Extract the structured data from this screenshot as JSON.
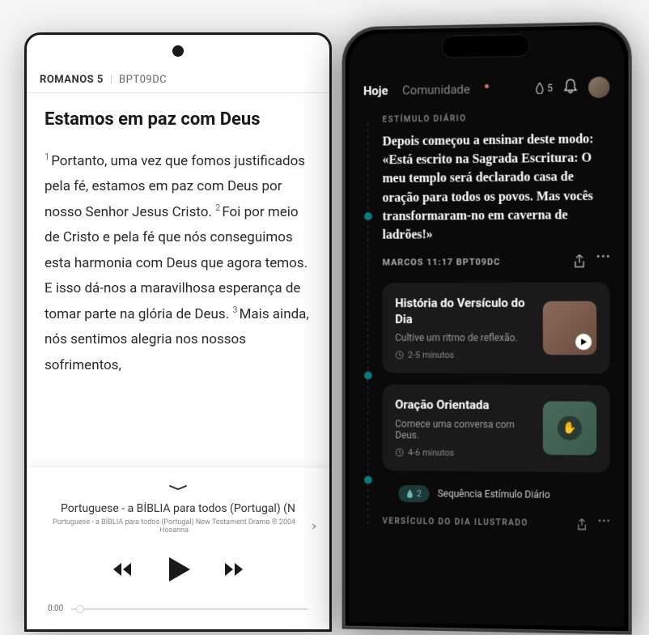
{
  "phone1": {
    "header": {
      "book": "ROMANOS 5",
      "version": "BPT09DC"
    },
    "title": "Estamos em paz com Deus",
    "verses": [
      {
        "num": "1",
        "text": "Portanto, uma vez que fomos justificados pela fé, estamos em paz com Deus por nosso Senhor Jesus Cristo. "
      },
      {
        "num": "2",
        "text": "Foi por meio de Cristo e pela fé que nós conseguimos esta harmonia com Deus que agora temos. E isso dá-nos a maravilhosa esperança de tomar parte na glória de Deus. "
      },
      {
        "num": "3",
        "text": "Mais ainda, nós sentimos alegria nos nossos sofrimentos,"
      }
    ],
    "player": {
      "title": "Portuguese - a BÍBLIA para todos (Portugal) (N",
      "subtitle": "Portuguese - a BÍBLIA para todos (Portugal) New Testament Drama ® 2004 Hosanna",
      "time": "0:00"
    }
  },
  "phone2": {
    "tabs": {
      "today": "Hoje",
      "community": "Comunidade"
    },
    "streak_count": "5",
    "daily": {
      "label": "ESTÍMULO DIÁRIO",
      "verse": "Depois começou a ensinar deste modo: «Está escrito na Sagrada Escritura: O meu templo será declarado casa de oração para todos os povos. Mas vocês transformaram-no em caverna de ladrões!»",
      "ref": "MARCOS 11:17 BPT09DC"
    },
    "card1": {
      "title": "História do Versículo do Dia",
      "subtitle": "Cultive um ritmo de reflexão.",
      "duration": "2-5 minutos"
    },
    "card2": {
      "title": "Oração Orientada",
      "subtitle": "Comece uma conversa com Deus.",
      "duration": "4-6 minutos"
    },
    "streak_pill": {
      "count": "2",
      "label": "Sequência Estímulo Diário"
    },
    "illustrated_label": "VERSÍCULO DO DIA ILUSTRADO"
  }
}
